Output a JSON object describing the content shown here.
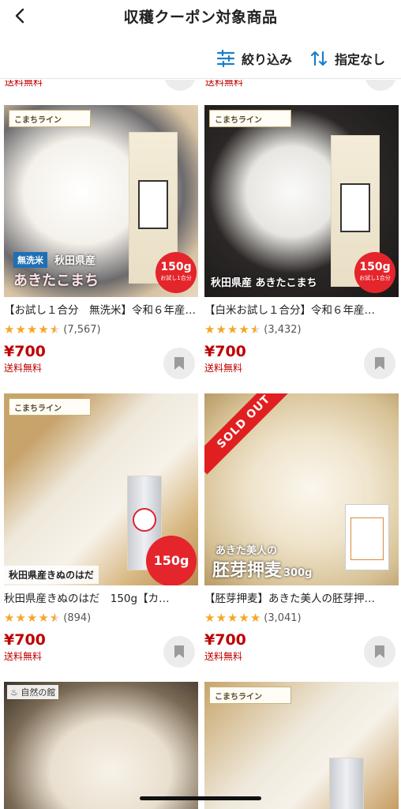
{
  "header": {
    "title": "収穫クーポン対象商品"
  },
  "toolbar": {
    "filter_label": "絞り込み",
    "sort_label": "指定なし"
  },
  "strip": {
    "free_left": "送料無料",
    "free_right": "送料無料"
  },
  "products": [
    {
      "brand": "こまちライン",
      "badge_type": "無洗米",
      "caption": "秋田県産",
      "caption2": "あきたこまち",
      "weight": "150g",
      "weight_sub": "お試し1合分",
      "name": "【お試し１合分　無洗米】令和６年産…",
      "rating": 4.5,
      "review_count": "(7,567)",
      "price": "¥700",
      "shipping": "送料無料"
    },
    {
      "brand": "こまちライン",
      "caption": "秋田県産 あきたこまち",
      "weight": "150g",
      "weight_sub": "お試し1合分",
      "name": "【白米お試し１合分】令和６年産…",
      "rating": 4.5,
      "review_count": "(3,432)",
      "price": "¥700",
      "shipping": "送料無料"
    },
    {
      "brand": "こまちライン",
      "caption": "秋田県産きぬのはだ",
      "weight": "150g",
      "name": "秋田県産きぬのはだ　150g【カ…",
      "rating": 4.5,
      "review_count": "(894)",
      "price": "¥700",
      "shipping": "送料無料"
    },
    {
      "sold_out": "SOLD OUT",
      "caption_small": "あきた美人の",
      "caption": "胚芽押麦",
      "weight": "300g",
      "name": "【胚芽押麦】あきた美人の胚芽押…",
      "rating": 5,
      "review_count": "(3,041)",
      "price": "¥700",
      "shipping": "送料無料"
    }
  ],
  "bottom_row": [
    {
      "label": "自然の館"
    },
    {
      "brand": "こまちライン"
    }
  ],
  "colors": {
    "price_red": "#bf0000",
    "star": "#f5a623",
    "badge_red": "#e4252b"
  }
}
